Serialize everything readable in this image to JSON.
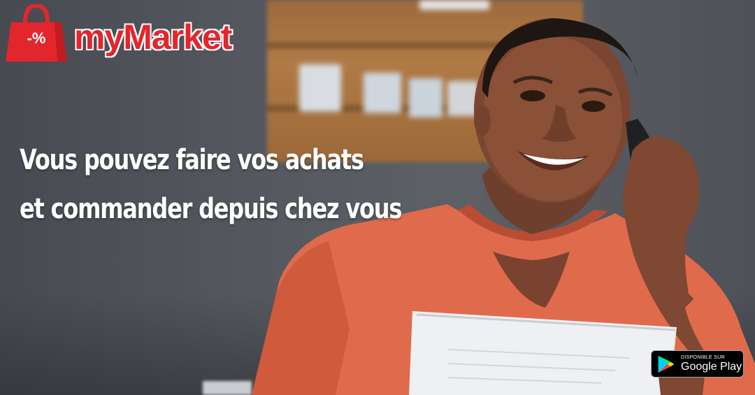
{
  "logo": {
    "bag_label": "-%",
    "brand": "myMarket"
  },
  "headline": {
    "line1": "Vous pouvez faire vos achats",
    "line2": "et commander depuis chez vous"
  },
  "store_badge": {
    "small": "DISPONIBLE SUR",
    "big": "Google Play"
  },
  "colors": {
    "brand_red": "#e3262d",
    "shirt": "#e06b4c",
    "background": "#55595f"
  }
}
